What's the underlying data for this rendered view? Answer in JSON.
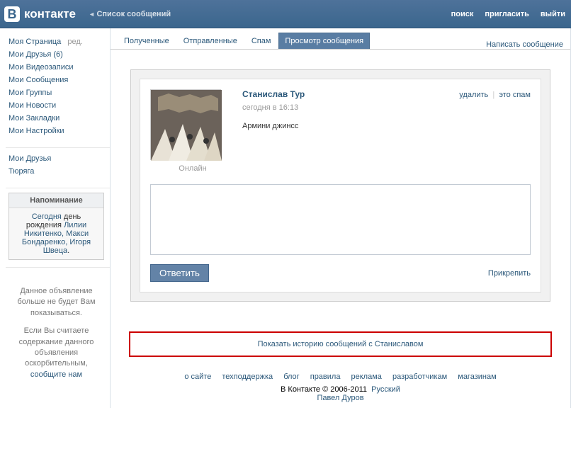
{
  "header": {
    "brand": "контакте",
    "breadcrumb": "Список сообщений",
    "nav": {
      "search": "поиск",
      "invite": "пригласить",
      "logout": "выйти"
    }
  },
  "sidebar": {
    "items": {
      "my_page": "Моя Страница",
      "edit": "ред.",
      "friends": "Мои Друзья (6)",
      "videos": "Мои Видеозаписи",
      "messages": "Мои Сообщения",
      "groups": "Мои Группы",
      "news": "Мои Новости",
      "bookmarks": "Мои Закладки",
      "settings": "Мои Настройки"
    },
    "extra": {
      "friends2": "Мои Друзья",
      "tyuryaga": "Тюряга"
    },
    "reminder": {
      "title": "Напоминание",
      "today": "Сегодня",
      "birthday_text": " день рождения ",
      "names": "Лилии Никитенко, Макси Бондаренко, Игоря Швеца"
    },
    "ad": {
      "line1": "Данное объявление больше не будет Вам показываться.",
      "line2": "Если Вы считаете содержание данного объявления оскорбительным,",
      "report": "сообщите нам"
    }
  },
  "tabs": {
    "inbox": "Полученные",
    "outbox": "Отправленные",
    "spam": "Спам",
    "view": "Просмотр сообщения",
    "compose": "Написать сообщение"
  },
  "message": {
    "sender": "Станислав Тур",
    "actions": {
      "delete": "удалить",
      "spam": "это спам"
    },
    "time": "сегодня в 16:13",
    "body": "Армини джинсс",
    "online": "Онлайн"
  },
  "reply": {
    "button": "Ответить",
    "attach": "Прикрепить"
  },
  "history": "Показать историю сообщений с Станиславом",
  "footer": {
    "links": {
      "about": "о сайте",
      "support": "техподдержка",
      "blog": "блог",
      "rules": "правила",
      "ads": "реклама",
      "devs": "разработчикам",
      "shops": "магазинам"
    },
    "copyright": "В Контакте © 2006-2011",
    "lang": "Русский",
    "author": "Павел Дуров"
  }
}
